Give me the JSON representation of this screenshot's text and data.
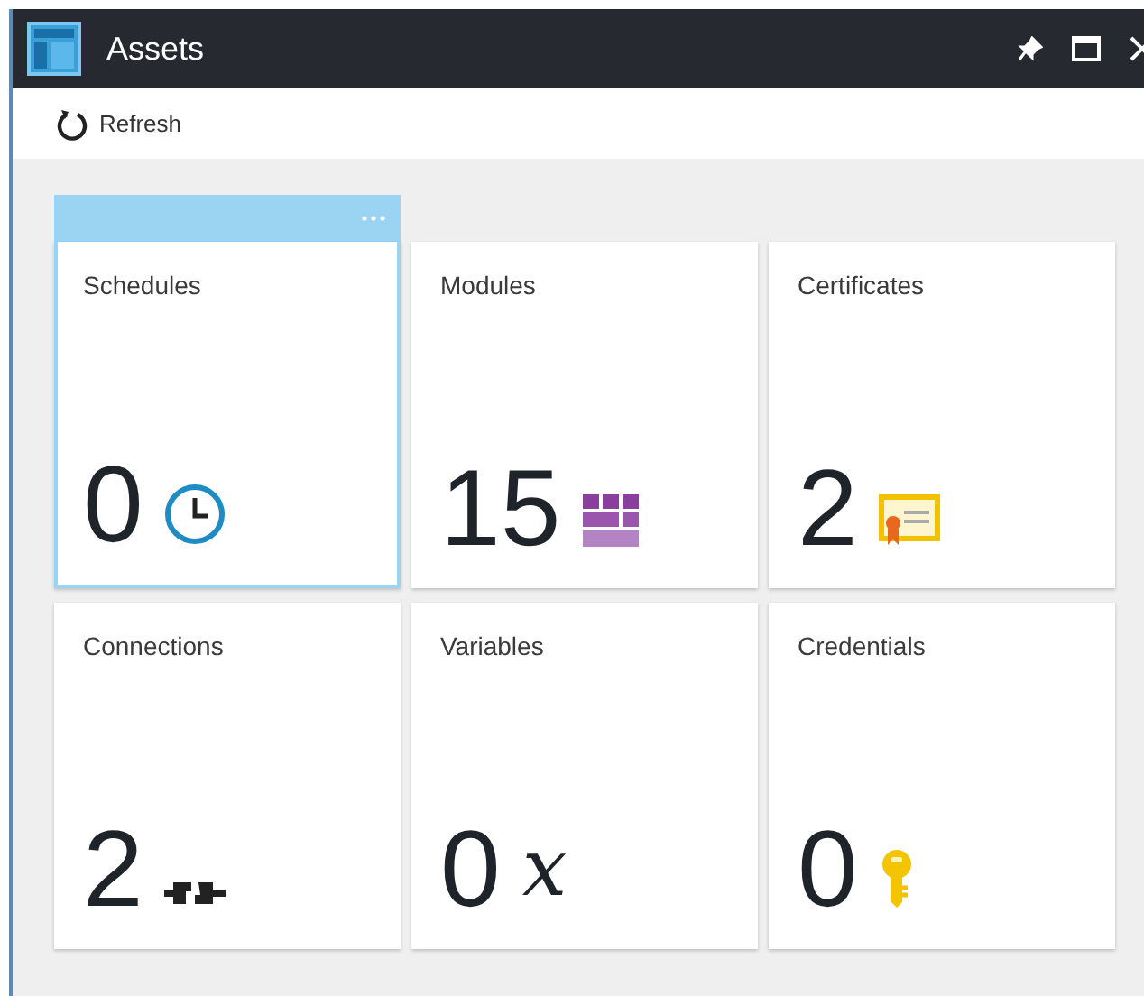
{
  "window": {
    "title": "Assets"
  },
  "toolbar": [
    {
      "label": "Refresh"
    }
  ],
  "tiles": [
    {
      "title": "Schedules",
      "count": "0",
      "kind": "clock",
      "selected": true
    },
    {
      "title": "Modules",
      "count": "15",
      "kind": "modules",
      "selected": false
    },
    {
      "title": "Certificates",
      "count": "2",
      "kind": "certificate",
      "selected": false
    },
    {
      "title": "Connections",
      "count": "2",
      "kind": "connection",
      "selected": false
    },
    {
      "title": "Variables",
      "count": "0",
      "kind": "variable",
      "symbol": "x",
      "selected": false
    },
    {
      "title": "Credentials",
      "count": "0",
      "kind": "key",
      "selected": false
    }
  ]
}
